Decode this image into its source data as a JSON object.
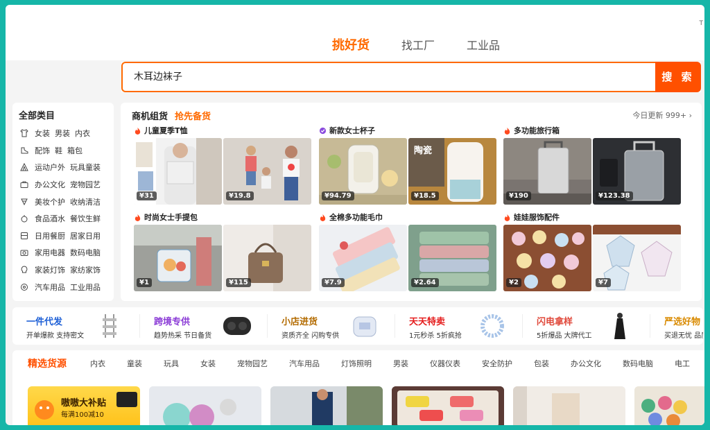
{
  "top_tabs": [
    "挑好货",
    "找工厂",
    "工业品"
  ],
  "corner_text": "T",
  "search": {
    "value": "木耳边袜子",
    "button": "搜 索"
  },
  "categories": {
    "title": "全部类目",
    "rows": [
      {
        "icon": "shirt-icon",
        "a": "女装",
        "b": "男装",
        "c": "内衣"
      },
      {
        "icon": "shoe-icon",
        "a": "配饰",
        "b": "鞋",
        "c": "箱包"
      },
      {
        "icon": "tent-icon",
        "a": "运动户外",
        "b": "玩具童装"
      },
      {
        "icon": "briefcase-icon",
        "a": "办公文化",
        "b": "宠物园艺"
      },
      {
        "icon": "lipstick-icon",
        "a": "美妆个护",
        "b": "收纳清洁"
      },
      {
        "icon": "bottle-icon",
        "a": "食品酒水",
        "b": "餐饮生鲜"
      },
      {
        "icon": "cabinet-icon",
        "a": "日用餐厨",
        "b": "居家日用"
      },
      {
        "icon": "camera-icon",
        "a": "家用电器",
        "b": "数码电脑"
      },
      {
        "icon": "bulb-icon",
        "a": "家装灯饰",
        "b": "家纺家饰"
      },
      {
        "icon": "wheel-icon",
        "a": "汽车用品",
        "b": "工业用品"
      }
    ]
  },
  "main": {
    "head_a": "商机组货",
    "head_b": "抢先备货",
    "update": "今日更新 999+ ›",
    "groups": [
      {
        "title": "儿童夏季T恤",
        "icon": "fire-icon",
        "prices": [
          "¥31",
          "¥19.8"
        ]
      },
      {
        "title": "新款女士杯子",
        "icon": "badge-icon",
        "prices": [
          "¥94.79",
          "¥18.5"
        ]
      },
      {
        "title": "多功能旅行箱",
        "icon": "fire-icon",
        "prices": [
          "¥190",
          "¥123.38"
        ]
      },
      {
        "title": "时尚女士手提包",
        "icon": "fire-icon",
        "prices": [
          "¥1",
          "¥115"
        ]
      },
      {
        "title": "全棉多功能毛巾",
        "icon": "fire-icon",
        "prices": [
          "¥7.9",
          "¥2.64"
        ]
      },
      {
        "title": "娃娃服饰配件",
        "icon": "fire-icon",
        "prices": [
          "¥2",
          "¥7"
        ]
      }
    ]
  },
  "promos": [
    {
      "title": "一件代发",
      "sub": "开单爆款  支持密文",
      "color": "#1d5fd6"
    },
    {
      "title": "跨境专供",
      "sub": "趋势热采  节日备货",
      "color": "#8a3ad6"
    },
    {
      "title": "小店进货",
      "sub": "资质齐全  闪购专供",
      "color": "#b36b00"
    },
    {
      "title": "天天特卖",
      "sub": "1元秒杀  5折疯抢",
      "color": "#e51d1d"
    },
    {
      "title": "闪电拿样",
      "sub": "5折爆品  大牌代工",
      "color": "#e0483a"
    },
    {
      "title": "严选好物",
      "sub": "买退无忧  品质好",
      "color": "#d98a00"
    }
  ],
  "feature": {
    "head": "精选货源",
    "cats": [
      "内衣",
      "童装",
      "玩具",
      "女装",
      "宠物园艺",
      "汽车用品",
      "灯饰照明",
      "男装",
      "仪器仪表",
      "安全防护",
      "包装",
      "办公文化",
      "数码电脑",
      "电工"
    ],
    "ad": {
      "title": "嗷嗷大补贴",
      "sub": "每满100减10"
    }
  }
}
